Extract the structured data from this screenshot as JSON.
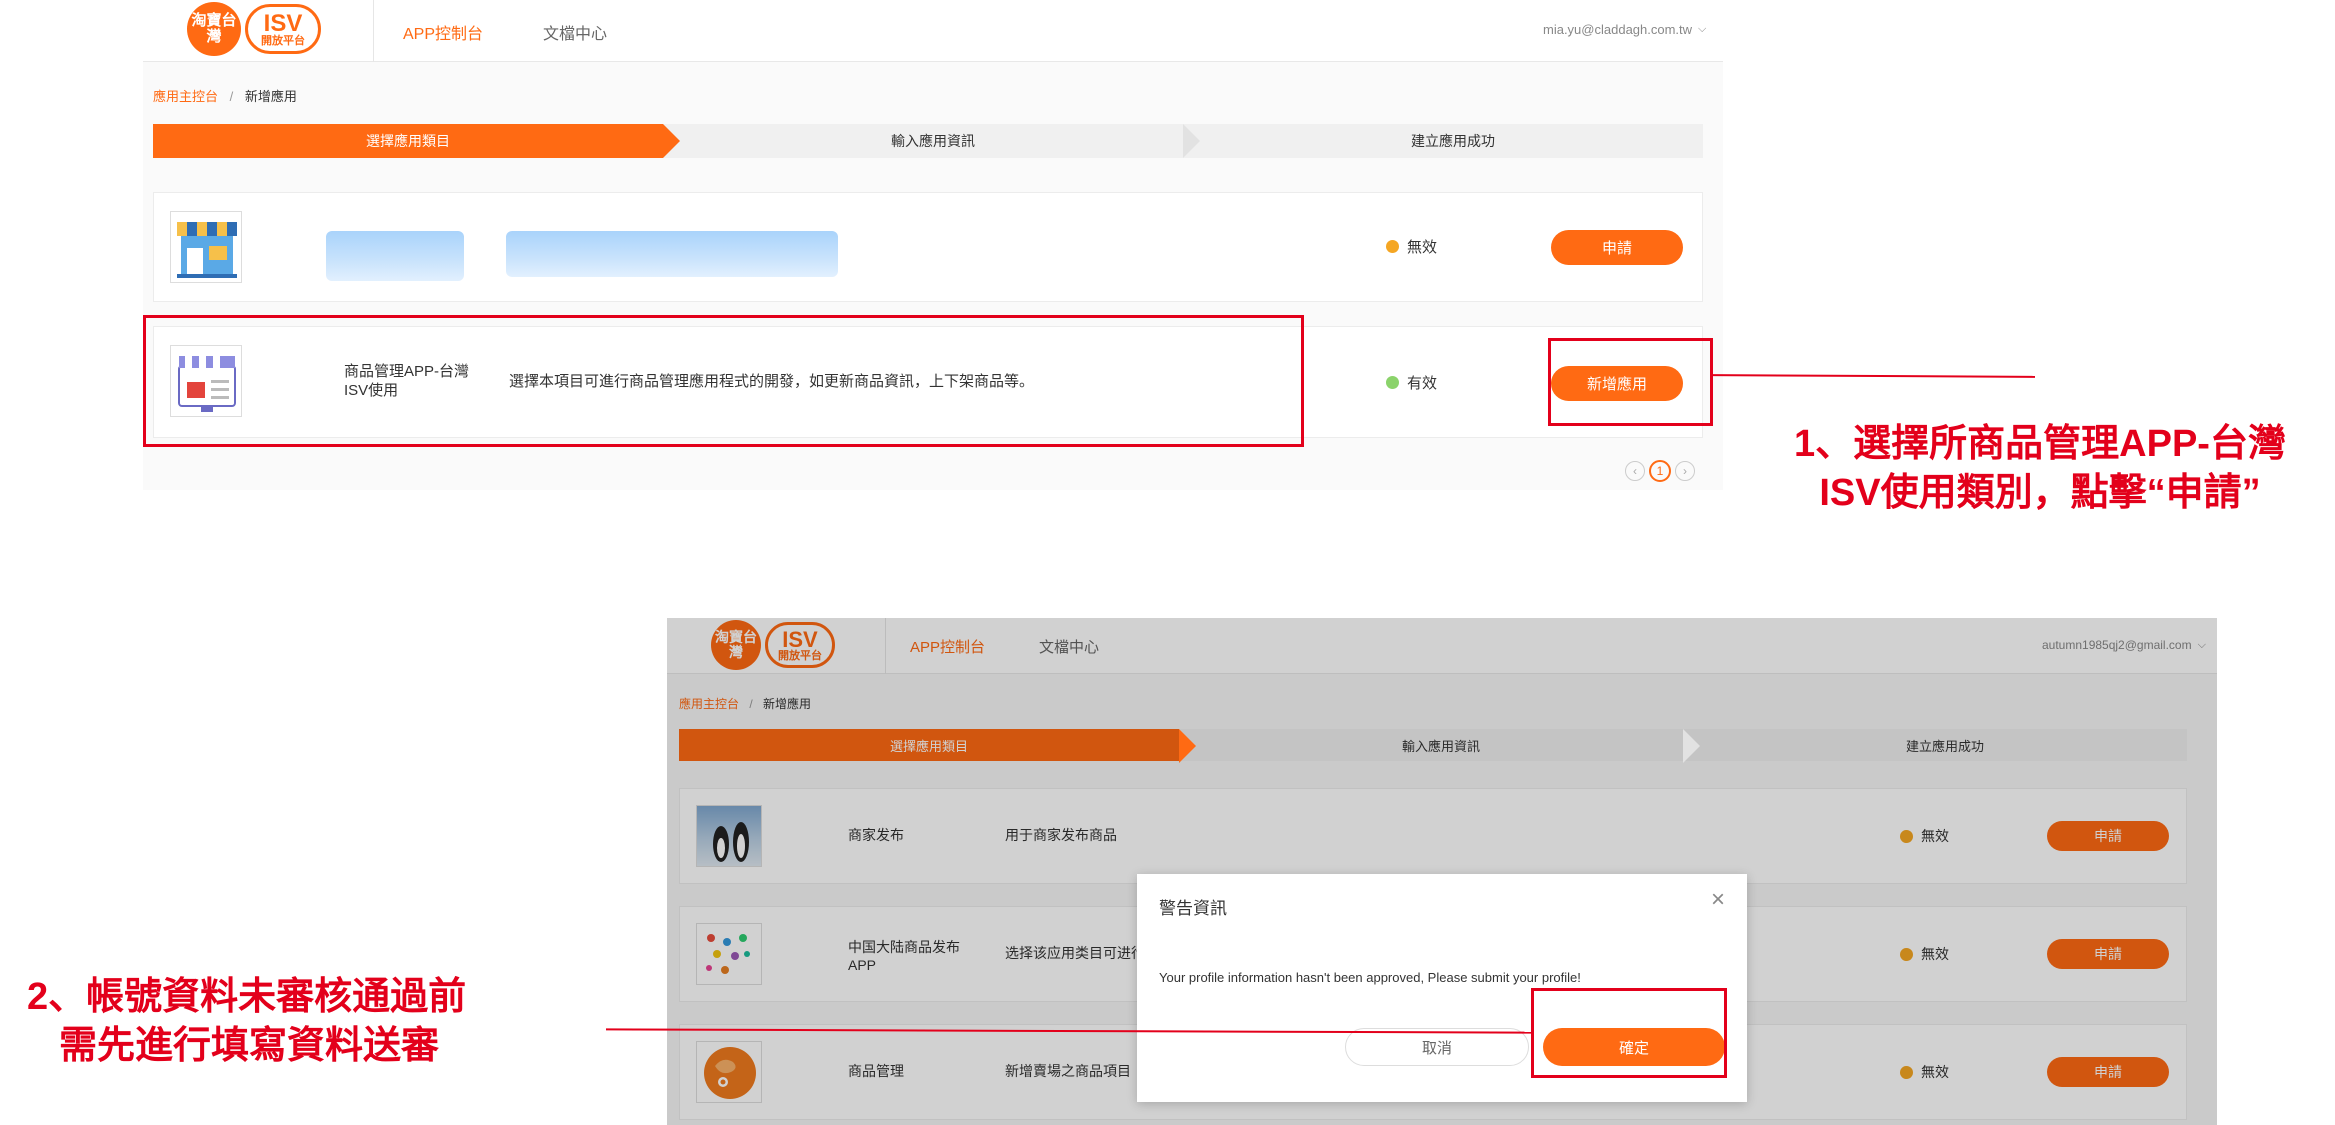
{
  "top": {
    "logo": {
      "circle_text": "淘寶台灣",
      "isv_text": "ISV",
      "isv_sub": "開放平台"
    },
    "nav": {
      "console": "APP控制台",
      "docs": "文檔中心"
    },
    "user_email": "mia.yu@claddagh.com.tw",
    "breadcrumb": {
      "root": "應用主控台",
      "sep": "/",
      "current": "新增應用"
    },
    "steps": [
      "選擇應用類目",
      "輸入應用資訊",
      "建立應用成功"
    ],
    "rows": [
      {
        "name": "",
        "desc": "",
        "status": "無效",
        "button": "申請"
      },
      {
        "name": "商品管理APP-台灣ISV使用",
        "desc": "選擇本項目可進行商品管理應用程式的開發，如更新商品資訊，上下架商品等。",
        "status": "有效",
        "button": "新增應用"
      }
    ],
    "pagination": {
      "current": "1"
    }
  },
  "callout1": {
    "line1": "1、選擇所商品管理APP-台灣",
    "line2": "ISV使用類別，點擊“申請”"
  },
  "bottom": {
    "logo": {
      "circle_text": "淘寶台灣",
      "isv_text": "ISV",
      "isv_sub": "開放平台"
    },
    "nav": {
      "console": "APP控制台",
      "docs": "文檔中心"
    },
    "user_email": "autumn1985qj2@gmail.com",
    "breadcrumb": {
      "root": "應用主控台",
      "sep": "/",
      "current": "新增應用"
    },
    "steps": [
      "選擇應用類目",
      "輸入應用資訊",
      "建立應用成功"
    ],
    "rows": [
      {
        "name": "商家发布",
        "desc": "用于商家发布商品",
        "status": "無效",
        "button": "申請"
      },
      {
        "name": "中国大陆商品发布APP",
        "desc": "选择该应用类目可进行",
        "status": "無效",
        "button": "申請"
      },
      {
        "name": "商品管理",
        "desc": "新增賣場之商品項目",
        "status": "無效",
        "button": "申請"
      }
    ],
    "modal": {
      "title": "警告資訊",
      "message": "Your profile information hasn't been approved, Please submit your profile!",
      "cancel": "取消",
      "ok": "確定"
    }
  },
  "callout2": {
    "line1": "2、帳號資料未審核通過前",
    "line2": "需先進行填寫資料送審"
  },
  "colors": {
    "accent": "#ff6a13",
    "annotation": "#e3001b",
    "valid": "#8bd36b",
    "invalid": "#f5a623"
  },
  "icons": [
    "chevron-down-icon",
    "close-icon",
    "shop-icon",
    "product-manage-icon",
    "chevron-left-icon",
    "chevron-right-icon"
  ]
}
